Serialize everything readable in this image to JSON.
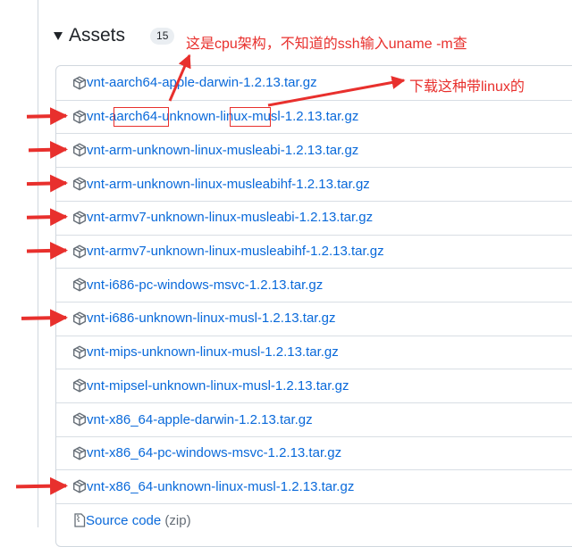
{
  "assets": {
    "title": "Assets",
    "count": "15"
  },
  "files": [
    {
      "name": "vnt-aarch64-apple-darwin-1.2.13.tar.gz",
      "marked": false
    },
    {
      "name": "vnt-aarch64-unknown-linux-musl-1.2.13.tar.gz",
      "marked": true
    },
    {
      "name": "vnt-arm-unknown-linux-musleabi-1.2.13.tar.gz",
      "marked": true
    },
    {
      "name": "vnt-arm-unknown-linux-musleabihf-1.2.13.tar.gz",
      "marked": true
    },
    {
      "name": "vnt-armv7-unknown-linux-musleabi-1.2.13.tar.gz",
      "marked": true
    },
    {
      "name": "vnt-armv7-unknown-linux-musleabihf-1.2.13.tar.gz",
      "marked": true
    },
    {
      "name": "vnt-i686-pc-windows-msvc-1.2.13.tar.gz",
      "marked": false
    },
    {
      "name": "vnt-i686-unknown-linux-musl-1.2.13.tar.gz",
      "marked": true
    },
    {
      "name": "vnt-mips-unknown-linux-musl-1.2.13.tar.gz",
      "marked": false
    },
    {
      "name": "vnt-mipsel-unknown-linux-musl-1.2.13.tar.gz",
      "marked": false
    },
    {
      "name": "vnt-x86_64-apple-darwin-1.2.13.tar.gz",
      "marked": false
    },
    {
      "name": "vnt-x86_64-pc-windows-msvc-1.2.13.tar.gz",
      "marked": false
    },
    {
      "name": "vnt-x86_64-unknown-linux-musl-1.2.13.tar.gz",
      "marked": true
    }
  ],
  "source": {
    "label": "Source code",
    "suffix": "(zip)"
  },
  "annotations": {
    "cpu_note": "这是cpu架构，不知道的ssh输入uname -m查",
    "linux_note": "下载这种带linux的"
  },
  "colors": {
    "link": "#0969da",
    "annotation": "#e8302d",
    "border": "#d0d7de"
  },
  "icons": {
    "row_icon": "package-icon",
    "source_icon": "file-zip-icon",
    "header_icon": "triangle-down-icon"
  }
}
